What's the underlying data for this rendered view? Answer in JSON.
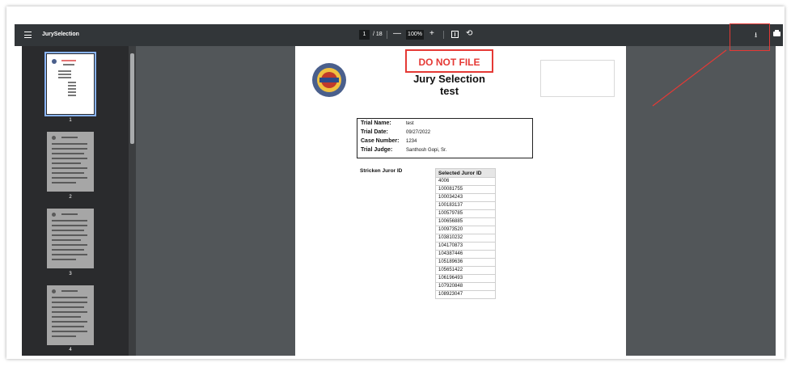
{
  "toolbar": {
    "title": "JurySelection",
    "current_page": "1",
    "page_total": "/ 18",
    "zoom_out": "—",
    "zoom": "100%",
    "zoom_in": "+",
    "rotate": "⟲",
    "download": "⭳",
    "more": "⋮"
  },
  "thumbnails": [
    {
      "label": "1"
    },
    {
      "label": "2"
    },
    {
      "label": "3"
    },
    {
      "label": "4"
    }
  ],
  "document": {
    "stamp": "DO NOT FILE",
    "title": "Jury Selection",
    "subtitle": "test",
    "info": [
      {
        "label": "Trial Name:",
        "value": "test"
      },
      {
        "label": "Trial Date:",
        "value": "09/27/2022"
      },
      {
        "label": "Case Number:",
        "value": "1234"
      },
      {
        "label": "Trial Judge:",
        "value": "Santhosh Gopi, Sr."
      }
    ],
    "stricken_header": "Stricken Juror ID",
    "selected_header": "Selected Juror ID",
    "selected_ids": [
      "4006",
      "100081755",
      "100034243",
      "100183137",
      "100579785",
      "100656885",
      "100973520",
      "103810232",
      "104170873",
      "104387446",
      "105189636",
      "105651422",
      "106196493",
      "107920848",
      "108923047"
    ]
  },
  "colors": {
    "toolbar": "#323639",
    "viewer": "#525659",
    "annotation": "#e53935",
    "active_thumb": "#8ab4f8"
  }
}
